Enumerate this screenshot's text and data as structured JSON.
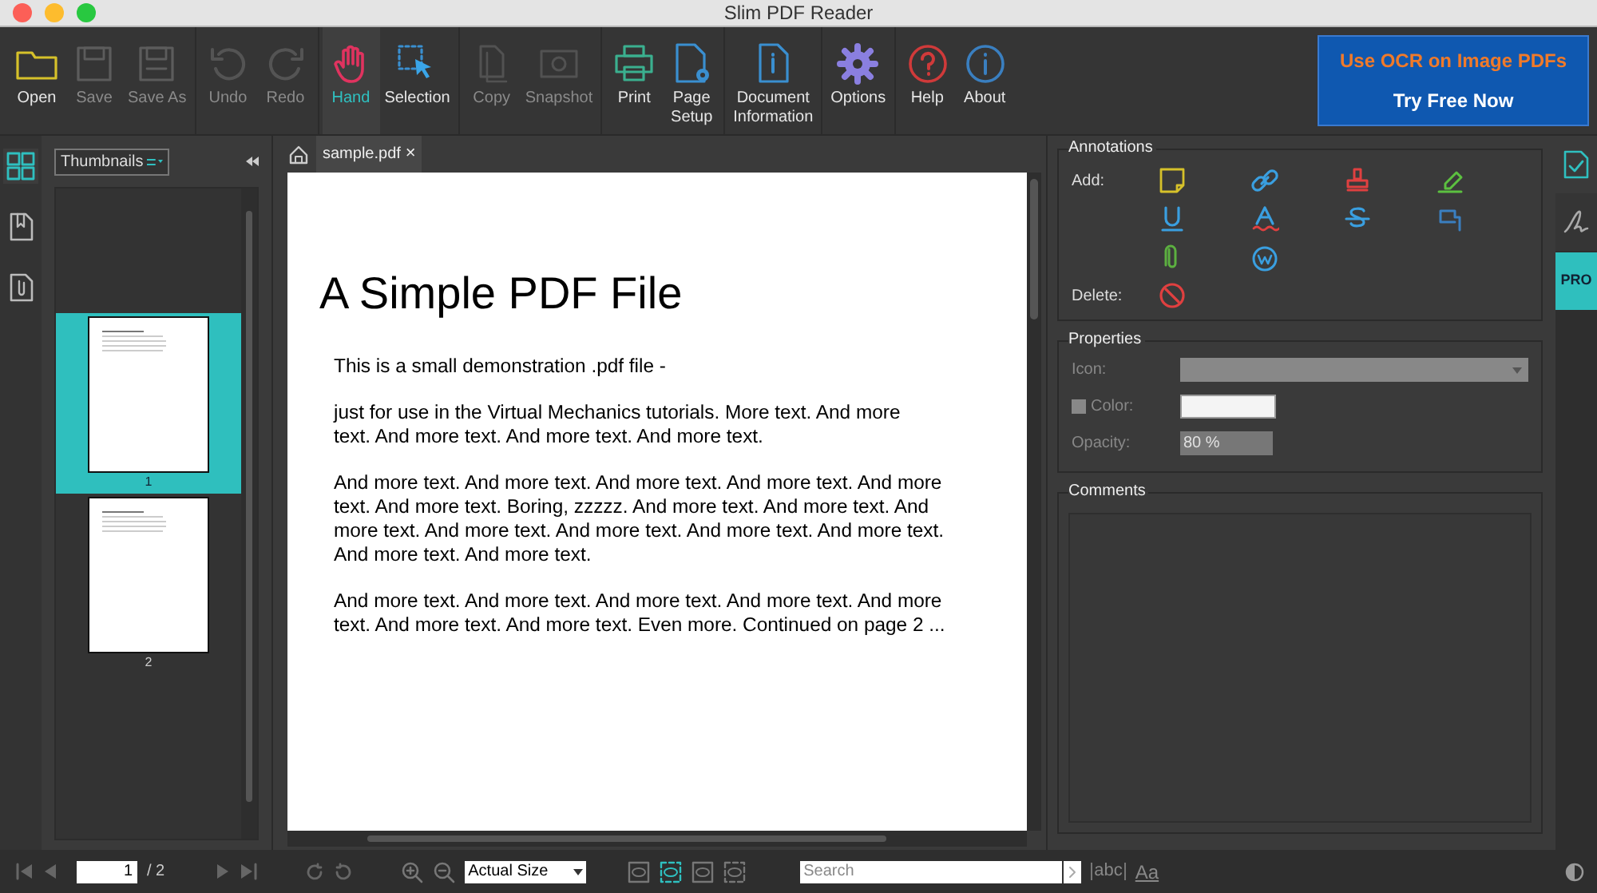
{
  "window": {
    "title": "Slim PDF Reader"
  },
  "toolbar": [
    [
      {
        "kind": "open",
        "label": "Open",
        "disabled": false,
        "selected": false
      },
      {
        "kind": "save",
        "label": "Save",
        "disabled": true,
        "selected": false
      },
      {
        "kind": "saveas",
        "label": "Save As",
        "disabled": true,
        "selected": false
      }
    ],
    [
      {
        "kind": "undo",
        "label": "Undo",
        "disabled": true,
        "selected": false
      },
      {
        "kind": "redo",
        "label": "Redo",
        "disabled": true,
        "selected": false
      }
    ],
    [
      {
        "kind": "hand",
        "label": "Hand",
        "disabled": false,
        "selected": true
      },
      {
        "kind": "selection",
        "label": "Selection",
        "disabled": false,
        "selected": false
      }
    ],
    [
      {
        "kind": "copy",
        "label": "Copy",
        "disabled": true,
        "selected": false
      },
      {
        "kind": "snapshot",
        "label": "Snapshot",
        "disabled": true,
        "selected": false
      }
    ],
    [
      {
        "kind": "print",
        "label": "Print",
        "disabled": false,
        "selected": false
      },
      {
        "kind": "pagesetup",
        "label": "Page\nSetup",
        "disabled": false,
        "selected": false
      }
    ],
    [
      {
        "kind": "docinfo",
        "label": "Document\nInformation",
        "disabled": false,
        "selected": false
      }
    ],
    [
      {
        "kind": "options",
        "label": "Options",
        "disabled": false,
        "selected": false
      }
    ],
    [
      {
        "kind": "help",
        "label": "Help",
        "disabled": false,
        "selected": false
      },
      {
        "kind": "about",
        "label": "About",
        "disabled": false,
        "selected": false
      }
    ]
  ],
  "promo": {
    "headline": "Use OCR on Image PDFs",
    "action": "Try Free Now"
  },
  "left_rail": [
    {
      "kind": "thumbnails",
      "selected": true
    },
    {
      "kind": "bookmarks",
      "selected": false
    },
    {
      "kind": "attachments",
      "selected": false
    }
  ],
  "sidebar": {
    "view": "Thumbnails",
    "pages": [
      {
        "label": "1",
        "selected": true
      },
      {
        "label": "2",
        "selected": false
      }
    ]
  },
  "tabs": [
    {
      "label": "sample.pdf",
      "close": "×",
      "selected": true
    }
  ],
  "document": {
    "title": "A Simple PDF File",
    "paragraphs": [
      [
        "This is a small demonstration .pdf file -"
      ],
      [
        "just for use in the Virtual Mechanics tutorials. More text. And more",
        "text. And more text. And more text. And more text."
      ],
      [
        "And more text. And more text. And more text. And more text. And more",
        "text. And more text. Boring, zzzzz. And more text. And more text. And",
        "more text. And more text. And more text. And more text. And more text.",
        "And more text. And more text."
      ],
      [
        "And more text. And more text. And more text. And more text. And more",
        "text. And more text. And more text. Even more. Continued on page 2 ..."
      ]
    ]
  },
  "annotations": {
    "title": "Annotations",
    "add_label": "Add:",
    "tools": [
      {
        "kind": "note"
      },
      {
        "kind": "link"
      },
      {
        "kind": "stamp"
      },
      {
        "kind": "highlight"
      },
      {
        "kind": "underline"
      },
      {
        "kind": "squiggly"
      },
      {
        "kind": "strikeout"
      },
      {
        "kind": "callout"
      },
      {
        "kind": "attach"
      },
      {
        "kind": "watermark"
      }
    ],
    "delete_label": "Delete:"
  },
  "properties": {
    "title": "Properties",
    "icon_label": "Icon:",
    "color_label": "Color:",
    "color_checked": false,
    "color": "#f4f4f4",
    "opacity_label": "Opacity:",
    "opacity": "80 %"
  },
  "comments": {
    "title": "Comments"
  },
  "right_tabs": [
    {
      "kind": "review",
      "selected": false
    },
    {
      "kind": "sign",
      "selected": false
    },
    {
      "kind": "pro",
      "label": "PRO",
      "selected": true
    }
  ],
  "status_bar": {
    "page": "1",
    "total": "/ 2",
    "zoom": "Actual Size",
    "view_modes": [
      {
        "selected": false
      },
      {
        "selected": true
      },
      {
        "selected": false
      },
      {
        "selected": false
      }
    ],
    "search_placeholder": "Search",
    "whole_word": "abc",
    "match_case": "Aa"
  }
}
